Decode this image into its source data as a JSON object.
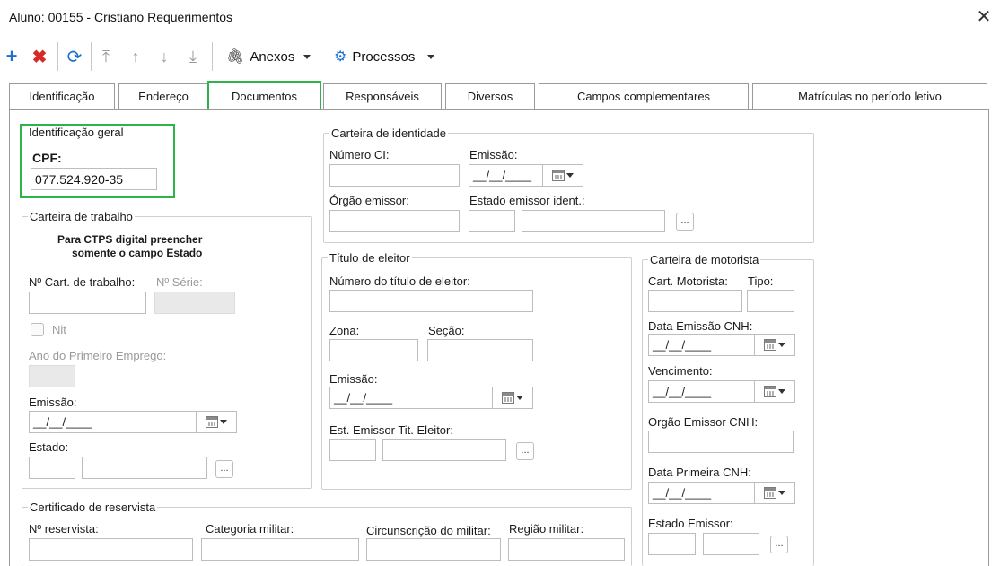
{
  "window": {
    "title": "Aluno: 00155 - Cristiano Requerimentos",
    "close_icon": "close-icon"
  },
  "toolbar": {
    "add_icon": "plus-icon",
    "delete_icon": "x-icon",
    "refresh_icon": "refresh-icon",
    "first_icon": "arrow-top-icon",
    "up_icon": "arrow-up-icon",
    "down_icon": "arrow-down-icon",
    "last_icon": "arrow-bottom-icon",
    "anexos_label": "Anexos",
    "processos_label": "Processos",
    "colors": {
      "add": "#1a6fd1",
      "delete": "#d62a2a",
      "refresh": "#1a6fd1",
      "processos_gear": "#1a6fd1"
    }
  },
  "tabs": [
    {
      "label": "Identificação"
    },
    {
      "label": "Endereço"
    },
    {
      "label": "Documentos"
    },
    {
      "label": "Responsáveis"
    },
    {
      "label": "Diversos"
    },
    {
      "label": "Campos complementares"
    },
    {
      "label": "Matrículas no período letivo"
    }
  ],
  "active_tab": "Documentos",
  "accent_highlight": "#2db34a",
  "ident_geral": {
    "legend": "Identificação geral",
    "cpf_label": "CPF:",
    "cpf_value": "077.524.920-35"
  },
  "carteira_trabalho": {
    "legend": "Carteira de trabalho",
    "note_line1": "Para CTPS digital preencher",
    "note_line2": "somente o campo Estado",
    "num_label": "Nº Cart. de trabalho:",
    "serie_label": "Nº Série:",
    "nit_label": "Nit",
    "ano_label": "Ano do Primeiro Emprego:",
    "emissao_label": "Emissão:",
    "emissao_value": "__/__/____",
    "estado_label": "Estado:"
  },
  "carteira_identidade": {
    "legend": "Carteira de identidade",
    "numero_label": "Número CI:",
    "emissao_label": "Emissão:",
    "emissao_value": "__/__/____",
    "orgao_label": "Órgão emissor:",
    "estado_label": "Estado emissor ident.:"
  },
  "titulo_eleitor": {
    "legend": "Título de eleitor",
    "numero_label": "Número do título de eleitor:",
    "zona_label": "Zona:",
    "secao_label": "Seção:",
    "emissao_label": "Emissão:",
    "emissao_value": "__/__/____",
    "est_label": "Est. Emissor Tit. Eleitor:"
  },
  "carteira_motorista": {
    "legend": "Carteira de motorista",
    "cart_label": "Cart. Motorista:",
    "tipo_label": "Tipo:",
    "data_emissao_label": "Data Emissão CNH:",
    "data_emissao_value": "__/__/____",
    "vencimento_label": "Vencimento:",
    "vencimento_value": "__/__/____",
    "orgao_label": "Orgão Emissor CNH:",
    "primeira_label": "Data Primeira CNH:",
    "primeira_value": "__/__/____",
    "estado_label": "Estado Emissor:"
  },
  "reservista": {
    "legend": "Certificado de reservista",
    "num_label": "Nº reservista:",
    "categoria_label": "Categoria militar:",
    "circ_label": "Circunscrição do militar:",
    "regiao_label": "Região militar:"
  },
  "ellipsis_text": "..."
}
